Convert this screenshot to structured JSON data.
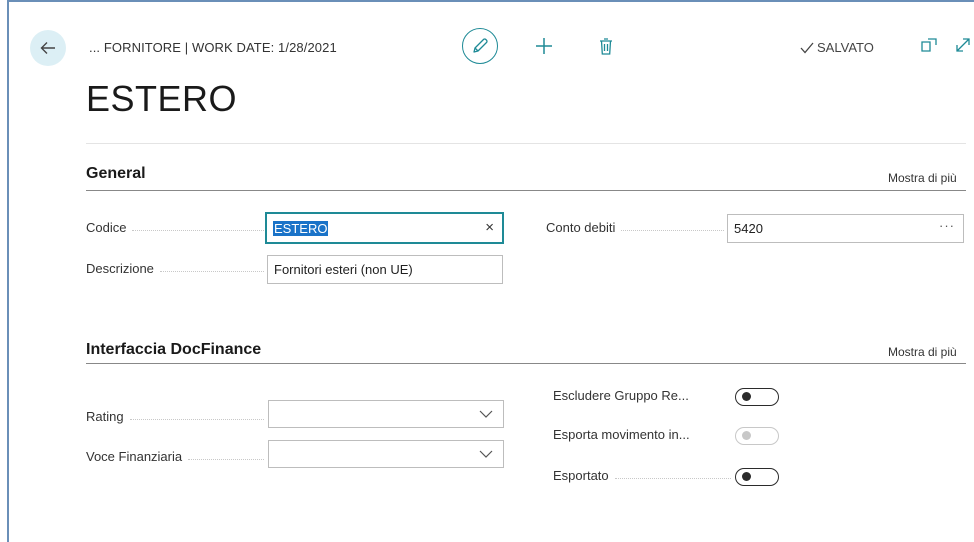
{
  "header": {
    "breadcrumb": "... FORNITORE | WORK DATE: 1/28/2021",
    "saved_label": "SALVATO"
  },
  "page": {
    "title": "ESTERO"
  },
  "general": {
    "title": "General",
    "show_more": "Mostra di più",
    "fields": {
      "codice": {
        "label": "Codice",
        "value": "ESTERO"
      },
      "descrizione": {
        "label": "Descrizione",
        "value": "Fornitori esteri (non UE)"
      },
      "conto_debiti": {
        "label": "Conto debiti",
        "value": "5420"
      }
    }
  },
  "docfinance": {
    "title": "Interfaccia DocFinance",
    "show_more": "Mostra di più",
    "fields": {
      "rating": {
        "label": "Rating",
        "value": ""
      },
      "voce_finanziaria": {
        "label": "Voce Finanziaria",
        "value": ""
      },
      "escludere_gruppo": {
        "label": "Escludere Gruppo Re...",
        "on": false
      },
      "esporta_movimento": {
        "label": "Esporta movimento in...",
        "on": false,
        "disabled": true
      },
      "esportato": {
        "label": "Esportato",
        "on": false
      }
    }
  },
  "icons": {
    "back": "arrow-left-icon",
    "edit": "pencil-icon",
    "new": "plus-icon",
    "delete": "trash-icon",
    "saved": "checkmark-icon",
    "open_new": "open-in-new-window-icon",
    "expand": "expand-icon"
  },
  "colors": {
    "accent": "#1e8a96",
    "selection": "#1a73c8",
    "back_bg": "#dceff5"
  }
}
